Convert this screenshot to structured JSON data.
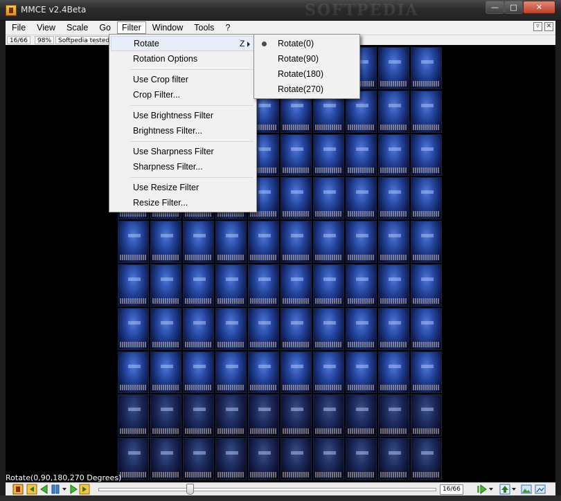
{
  "window": {
    "title": "MMCE v2.4Beta",
    "watermark": "SOFTPEDIA"
  },
  "menubar": {
    "items": [
      "File",
      "View",
      "Scale",
      "Go",
      "Filter",
      "Window",
      "Tools",
      "?"
    ]
  },
  "statusbar": {
    "page": "16/66",
    "zoom": "98%",
    "note": "Softpedia tested"
  },
  "filter_menu": {
    "items": [
      {
        "label": "Rotate",
        "shortcut": "Z"
      },
      {
        "label": "Rotation Options"
      },
      {
        "label": "Use Crop filter"
      },
      {
        "label": "Crop Filter..."
      },
      {
        "label": "Use Brightness Filter"
      },
      {
        "label": "Brightness Filter..."
      },
      {
        "label": "Use Sharpness Filter"
      },
      {
        "label": "Sharpness Filter..."
      },
      {
        "label": "Use Resize Filter"
      },
      {
        "label": "Resize Filter..."
      }
    ]
  },
  "rotate_submenu": {
    "items": [
      "Rotate(0)",
      "Rotate(90)",
      "Rotate(180)",
      "Rotate(270)"
    ],
    "selected_index": 0
  },
  "caption": "Rotate(0,90,180,270 Degrees)",
  "bottom_toolbar": {
    "page_counter": "16/66",
    "slider_position": 0.27
  },
  "colors": {
    "title_bar": "#2b2b2b",
    "menu_bg": "#f0f0f0",
    "thumb_blue": "#23449c",
    "close_button": "#c0402a"
  },
  "icons": [
    "minimize-icon",
    "maximize-icon",
    "close-icon",
    "submenu-arrow-icon",
    "radio-selected-icon",
    "first-page-icon",
    "prev-page-icon",
    "pause-icon",
    "next-page-icon",
    "last-page-icon",
    "play-icon",
    "up-arrow-icon",
    "image-icon"
  ]
}
